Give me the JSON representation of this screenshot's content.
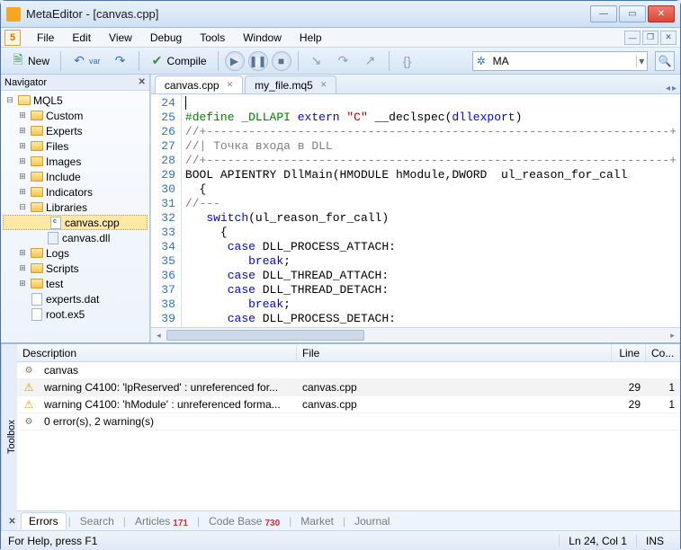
{
  "window": {
    "title": "MetaEditor - [canvas.cpp]"
  },
  "menu": {
    "items": [
      "File",
      "Edit",
      "View",
      "Debug",
      "Tools",
      "Window",
      "Help"
    ]
  },
  "toolbar": {
    "new_label": "New",
    "compile_label": "Compile",
    "search_value": "MA"
  },
  "navigator": {
    "title": "Navigator",
    "root": "MQL5",
    "folders": [
      "Custom",
      "Experts",
      "Files",
      "Images",
      "Include",
      "Indicators",
      "Libraries"
    ],
    "lib_children": [
      {
        "name": "canvas.cpp",
        "kind": "cpp",
        "selected": true
      },
      {
        "name": "canvas.dll",
        "kind": "dll"
      }
    ],
    "folders2": [
      "Logs",
      "Scripts",
      "test"
    ],
    "files_after": [
      {
        "name": "experts.dat",
        "kind": "dat"
      },
      {
        "name": "root.ex5",
        "kind": "ex5"
      }
    ]
  },
  "editor": {
    "tabs": [
      {
        "label": "canvas.cpp",
        "active": true
      },
      {
        "label": "my_file.mq5",
        "active": false
      }
    ],
    "first_line": 24,
    "lines": [
      {
        "n": 24,
        "seg": [
          {
            "t": "",
            "c": "k-caret"
          }
        ]
      },
      {
        "n": 25,
        "seg": [
          {
            "t": "#define _DLLAPI ",
            "c": "k-pp"
          },
          {
            "t": "extern ",
            "c": "k-kw"
          },
          {
            "t": "\"C\"",
            "c": "k-str"
          },
          {
            "t": " __declspec",
            "c": ""
          },
          {
            "t": "(",
            "c": ""
          },
          {
            "t": "dllexport",
            "c": "k-kw"
          },
          {
            "t": ")",
            "c": ""
          }
        ]
      },
      {
        "n": 26,
        "seg": [
          {
            "t": "//+------------------------------------------------------------------+",
            "c": "k-com"
          }
        ]
      },
      {
        "n": 27,
        "seg": [
          {
            "t": "//| Точка входа в DLL",
            "c": "k-com"
          }
        ]
      },
      {
        "n": 28,
        "seg": [
          {
            "t": "//+------------------------------------------------------------------+",
            "c": "k-com"
          }
        ]
      },
      {
        "n": 29,
        "seg": [
          {
            "t": "BOOL APIENTRY DllMain(HMODULE hModule,DWORD  ul_reason_for_call",
            "c": ""
          }
        ]
      },
      {
        "n": 30,
        "seg": [
          {
            "t": "  {",
            "c": ""
          }
        ]
      },
      {
        "n": 31,
        "seg": [
          {
            "t": "//---",
            "c": "k-com"
          }
        ]
      },
      {
        "n": 32,
        "seg": [
          {
            "t": "   ",
            "c": ""
          },
          {
            "t": "switch",
            "c": "k-kw"
          },
          {
            "t": "(ul_reason_for_call)",
            "c": ""
          }
        ]
      },
      {
        "n": 33,
        "seg": [
          {
            "t": "     {",
            "c": ""
          }
        ]
      },
      {
        "n": 34,
        "seg": [
          {
            "t": "      ",
            "c": ""
          },
          {
            "t": "case",
            "c": "k-kw"
          },
          {
            "t": " DLL_PROCESS_ATTACH:",
            "c": ""
          }
        ]
      },
      {
        "n": 35,
        "seg": [
          {
            "t": "         ",
            "c": ""
          },
          {
            "t": "break",
            "c": "k-kw"
          },
          {
            "t": ";",
            "c": ""
          }
        ]
      },
      {
        "n": 36,
        "seg": [
          {
            "t": "      ",
            "c": ""
          },
          {
            "t": "case",
            "c": "k-kw"
          },
          {
            "t": " DLL_THREAD_ATTACH:",
            "c": ""
          }
        ]
      },
      {
        "n": 37,
        "seg": [
          {
            "t": "      ",
            "c": ""
          },
          {
            "t": "case",
            "c": "k-kw"
          },
          {
            "t": " DLL_THREAD_DETACH:",
            "c": ""
          }
        ]
      },
      {
        "n": 38,
        "seg": [
          {
            "t": "         ",
            "c": ""
          },
          {
            "t": "break",
            "c": "k-kw"
          },
          {
            "t": ";",
            "c": ""
          }
        ]
      },
      {
        "n": 39,
        "seg": [
          {
            "t": "      ",
            "c": ""
          },
          {
            "t": "case",
            "c": "k-kw"
          },
          {
            "t": " DLL_PROCESS_DETACH:",
            "c": ""
          }
        ]
      }
    ]
  },
  "toolbox": {
    "label": "Toolbox",
    "columns": {
      "desc": "Description",
      "file": "File",
      "line": "Line",
      "col": "Co..."
    },
    "rows": [
      {
        "icon": "gear",
        "desc": "canvas",
        "file": "",
        "line": "",
        "col": "",
        "sel": false
      },
      {
        "icon": "warn",
        "desc": "warning C4100: 'lpReserved' : unreferenced for...",
        "file": "canvas.cpp",
        "line": "29",
        "col": "1",
        "sel": true
      },
      {
        "icon": "warn",
        "desc": "warning C4100: 'hModule' : unreferenced forma...",
        "file": "canvas.cpp",
        "line": "29",
        "col": "1",
        "sel": false
      },
      {
        "icon": "gear",
        "desc": "0 error(s), 2 warning(s)",
        "file": "",
        "line": "",
        "col": "",
        "sel": false
      }
    ],
    "tabs": [
      {
        "label": "Errors",
        "active": true
      },
      {
        "label": "Search"
      },
      {
        "label": "Articles",
        "badge": "171"
      },
      {
        "label": "Code Base",
        "badge": "730"
      },
      {
        "label": "Market"
      },
      {
        "label": "Journal"
      }
    ]
  },
  "status": {
    "help": "For Help, press F1",
    "pos": "Ln 24, Col 1",
    "ins": "INS"
  }
}
